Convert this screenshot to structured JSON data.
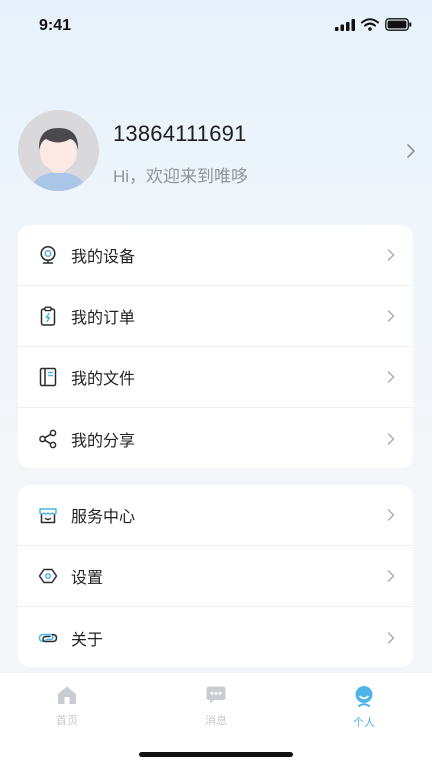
{
  "status_bar": {
    "time": "9:41"
  },
  "profile": {
    "phone": "13864111691",
    "greeting": "Hi，欢迎来到唯哆"
  },
  "menu_group_1": [
    {
      "label": "我的设备",
      "icon": "camera-icon"
    },
    {
      "label": "我的订单",
      "icon": "order-clipboard-icon"
    },
    {
      "label": "我的文件",
      "icon": "notebook-icon"
    },
    {
      "label": "我的分享",
      "icon": "share-icon"
    }
  ],
  "menu_group_2": [
    {
      "label": "服务中心",
      "icon": "store-icon"
    },
    {
      "label": "设置",
      "icon": "settings-hexagon-icon"
    },
    {
      "label": "关于",
      "icon": "link-loop-icon"
    }
  ],
  "tabbar": {
    "tabs": [
      {
        "label": "首页",
        "icon": "home-icon",
        "active": false
      },
      {
        "label": "消息",
        "icon": "message-icon",
        "active": false
      },
      {
        "label": "个人",
        "icon": "person-icon",
        "active": true
      }
    ]
  },
  "colors": {
    "accent": "#4fb4e8",
    "inactive": "#c4c7cc",
    "text": "#222222",
    "secondary_text": "#8f949b"
  }
}
